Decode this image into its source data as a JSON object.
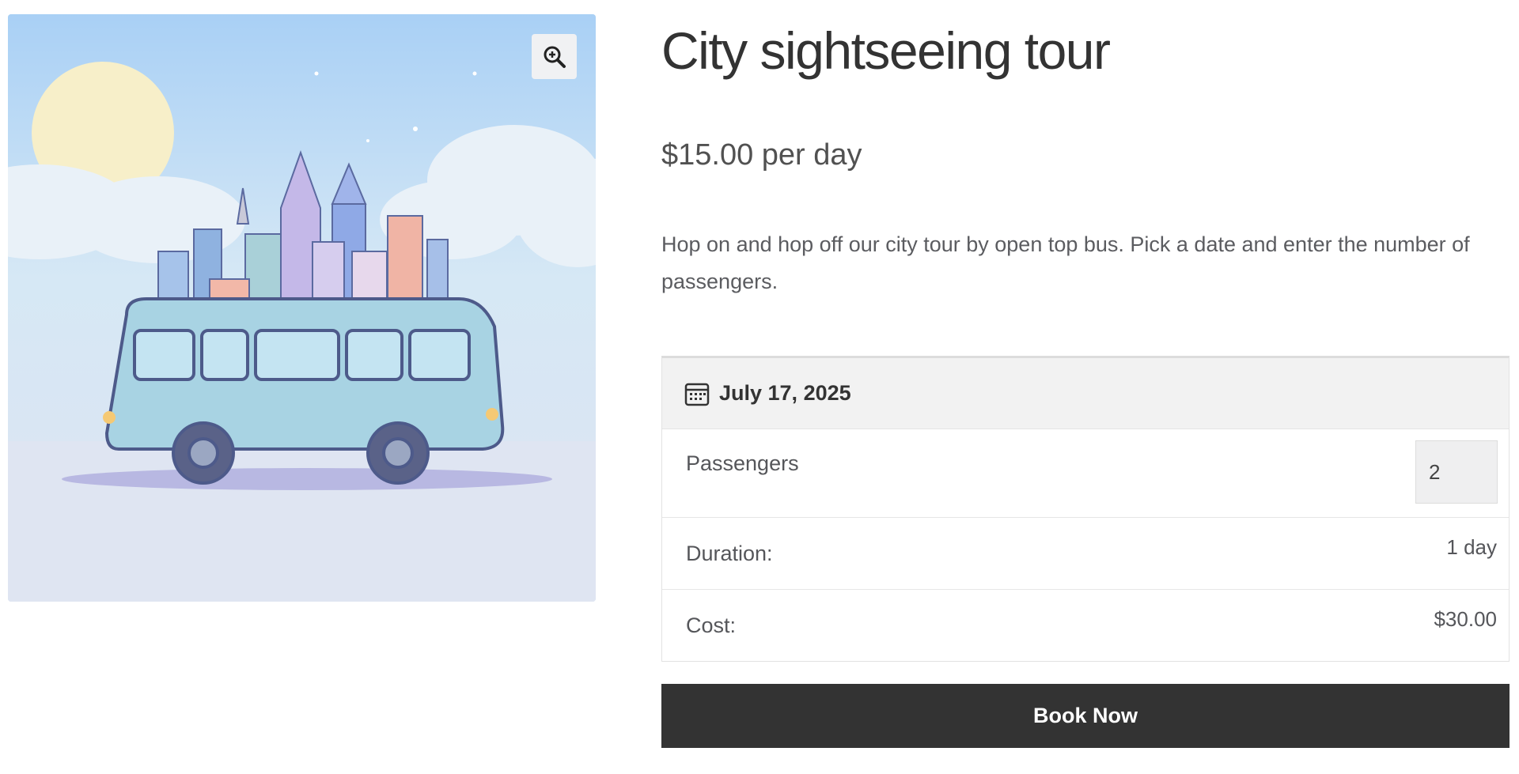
{
  "product": {
    "title": "City sightseeing tour",
    "price": "$15.00 per day",
    "description": "Hop on and hop off our city tour by open top bus. Pick a date and enter the number of passengers."
  },
  "booking": {
    "date": "July 17, 2025",
    "passengers_label": "Passengers",
    "passengers_value": "2",
    "duration_label": "Duration:",
    "duration_value": "1 day",
    "cost_label": "Cost:",
    "cost_value": "$30.00"
  },
  "actions": {
    "book_now_label": "Book Now"
  },
  "icons": {
    "zoom": "zoom-in-icon",
    "calendar": "calendar-icon"
  },
  "colors": {
    "button_bg": "#333333",
    "date_header_bg": "#f2f2f2",
    "image_sky": "#c5def5"
  }
}
